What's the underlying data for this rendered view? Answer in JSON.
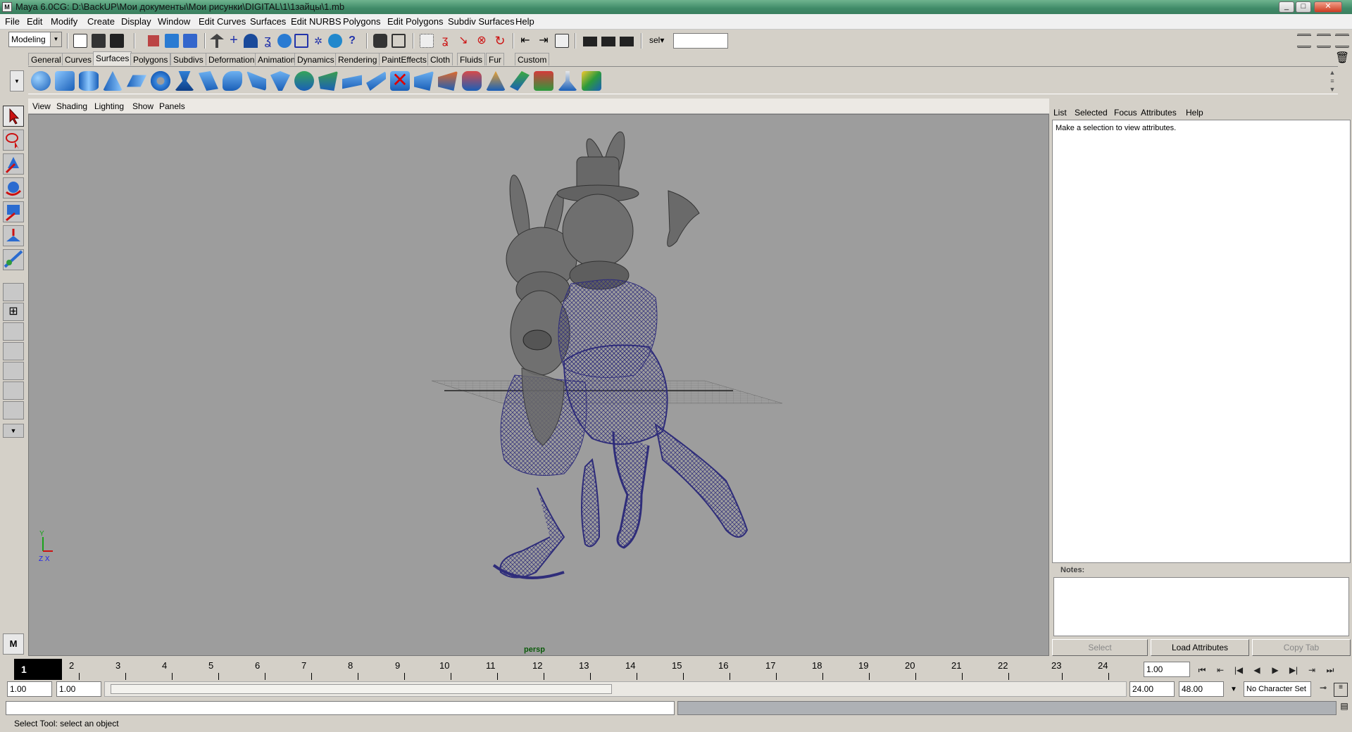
{
  "window": {
    "title": "Maya 6.0CG: D:\\BackUP\\Мои документы\\Мои рисунки\\DIGITAL\\1\\1зайцы\\1.mb"
  },
  "menubar": {
    "items": [
      "File",
      "Edit",
      "Modify",
      "Create",
      "Display",
      "Window",
      "Edit Curves",
      "Surfaces",
      "Edit NURBS",
      "Polygons",
      "Edit Polygons",
      "Subdiv Surfaces",
      "Help"
    ]
  },
  "statusline": {
    "mode": "Modeling",
    "sel_label": "sel",
    "sel_value": ""
  },
  "shelf": {
    "tabs": [
      "General",
      "Curves",
      "Surfaces",
      "Polygons",
      "Subdivs",
      "Deformation",
      "Animation",
      "Dynamics",
      "Rendering",
      "PaintEffects",
      "Cloth",
      "Fluids",
      "Fur",
      "Custom"
    ],
    "active_tab": "Surfaces",
    "icon_color": "#2f7fd6"
  },
  "viewport": {
    "menu": [
      "View",
      "Shading",
      "Lighting",
      "Show",
      "Panels"
    ],
    "camera_label": "persp",
    "axis_y": "Y",
    "axis_zx": "Z X",
    "bg_color": "#9d9d9d",
    "wire_color": "#2f2d7a"
  },
  "attribute_editor": {
    "menu": [
      "List",
      "Selected",
      "Focus",
      "Attributes",
      "Help"
    ],
    "message": "Make a selection to view attributes.",
    "notes_label": "Notes:",
    "buttons": [
      "Select",
      "Load Attributes",
      "Copy Tab"
    ]
  },
  "timeline": {
    "current_frame": "1",
    "ticks": [
      "2",
      "3",
      "4",
      "5",
      "6",
      "7",
      "8",
      "9",
      "10",
      "11",
      "12",
      "13",
      "14",
      "15",
      "16",
      "17",
      "18",
      "19",
      "20",
      "21",
      "22",
      "23",
      "24"
    ],
    "current_time_field": "1.00"
  },
  "range": {
    "start_time": "1.00",
    "playback_start": "1.00",
    "playback_end": "24.00",
    "end_time": "48.00",
    "character_set": "No Character Set"
  },
  "helpline": {
    "text": "Select Tool: select an object"
  }
}
